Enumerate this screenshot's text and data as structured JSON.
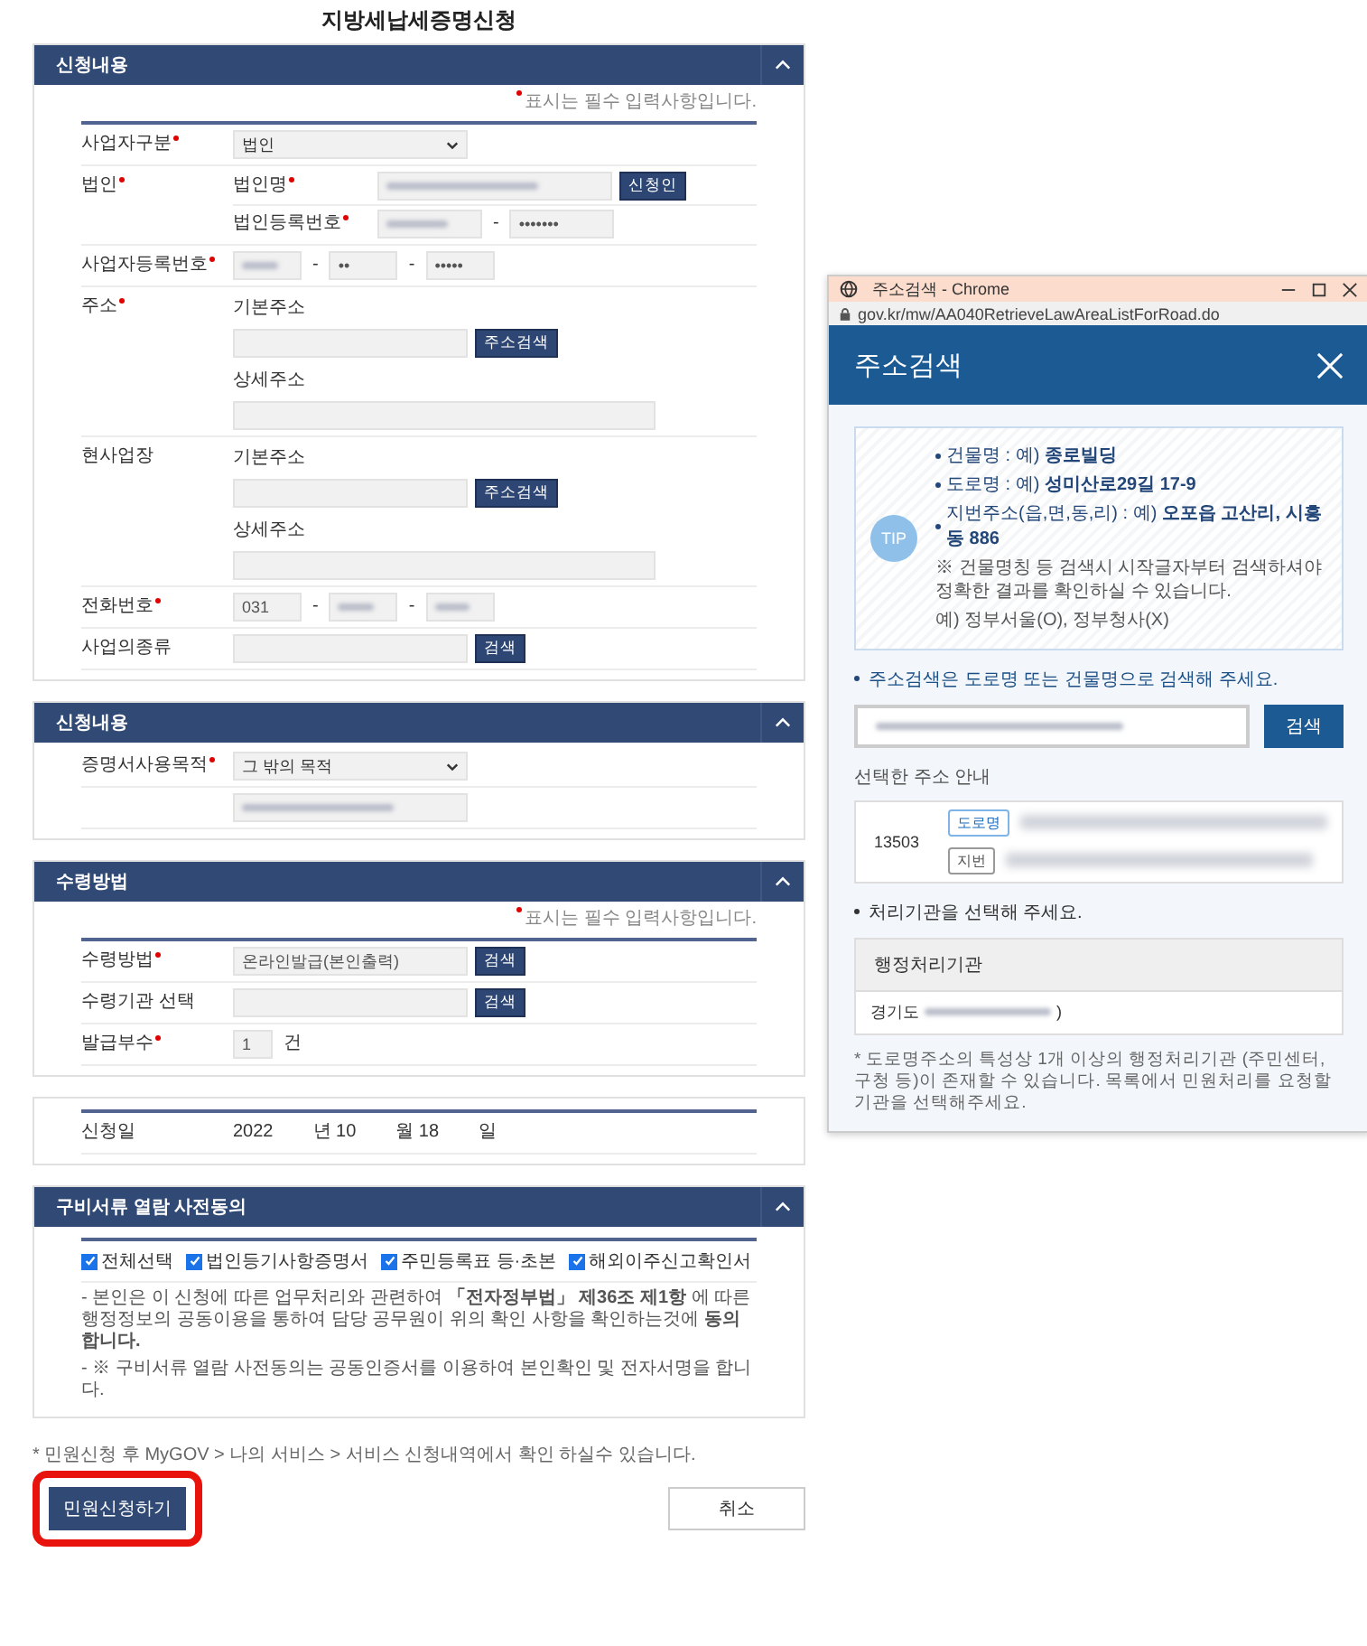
{
  "page_title": "지방세납세증명신청",
  "sections": [
    {
      "title": "신청내용",
      "expanded": true,
      "required_note": "표시는 필수 입력사항입니다.",
      "top_rule": true,
      "rows": [
        {
          "label": "사업자구분",
          "required": true,
          "lines": [
            {
              "parts": [
                {
                  "kind": "select",
                  "value": "법인"
                }
              ]
            }
          ]
        },
        {
          "label": "법인",
          "required": true,
          "lines": [
            {
              "parts": [
                {
                  "kind": "field-label",
                  "text": "법인명",
                  "required": true
                },
                {
                  "kind": "input",
                  "masked": true
                },
                {
                  "kind": "button",
                  "text": "신청인"
                }
              ]
            },
            {
              "parts": [
                {
                  "kind": "field-label",
                  "text": "법인등록번호",
                  "required": true
                },
                {
                  "kind": "mid-input",
                  "masked": true
                },
                {
                  "kind": "dash",
                  "text": "-"
                },
                {
                  "kind": "mid-input",
                  "value": "•••••••"
                }
              ]
            }
          ]
        },
        {
          "label": "사업자등록번호",
          "required": true,
          "lines": [
            {
              "parts": [
                {
                  "kind": "short-input",
                  "masked": true
                },
                {
                  "kind": "dash",
                  "text": "-"
                },
                {
                  "kind": "short-input",
                  "value": "••"
                },
                {
                  "kind": "dash",
                  "text": "-"
                },
                {
                  "kind": "short-input",
                  "value": "•••••"
                }
              ]
            }
          ]
        },
        {
          "label": "주소",
          "required": true,
          "lines": [
            {
              "parts": [
                {
                  "kind": "caption",
                  "text": "기본주소"
                }
              ]
            },
            {
              "parts": [
                {
                  "kind": "input"
                },
                {
                  "kind": "button",
                  "text": "주소검색"
                }
              ]
            },
            {
              "parts": [
                {
                  "kind": "caption",
                  "text": "상세주소"
                }
              ]
            },
            {
              "parts": [
                {
                  "kind": "wide-input"
                }
              ]
            }
          ]
        },
        {
          "label": "현사업장",
          "required": false,
          "lines": [
            {
              "parts": [
                {
                  "kind": "caption",
                  "text": "기본주소"
                }
              ]
            },
            {
              "parts": [
                {
                  "kind": "input"
                },
                {
                  "kind": "button",
                  "text": "주소검색"
                }
              ]
            },
            {
              "parts": [
                {
                  "kind": "caption",
                  "text": "상세주소"
                }
              ]
            },
            {
              "parts": [
                {
                  "kind": "wide-input"
                }
              ]
            }
          ]
        },
        {
          "label": "전화번호",
          "required": true,
          "lines": [
            {
              "parts": [
                {
                  "kind": "short-input",
                  "value": "031"
                },
                {
                  "kind": "dash",
                  "text": "-"
                },
                {
                  "kind": "short-input",
                  "masked": true
                },
                {
                  "kind": "dash",
                  "text": "-"
                },
                {
                  "kind": "short-input",
                  "masked": true
                }
              ]
            }
          ]
        },
        {
          "label": "사업의종류",
          "required": false,
          "lines": [
            {
              "parts": [
                {
                  "kind": "input"
                },
                {
                  "kind": "button",
                  "text": "검색"
                }
              ]
            }
          ]
        }
      ]
    },
    {
      "title": "신청내용",
      "expanded": true,
      "top_rule": false,
      "rows": [
        {
          "label": "증명서사용목적",
          "required": true,
          "lines": [
            {
              "parts": [
                {
                  "kind": "select",
                  "value": "그 밖의 목적"
                }
              ]
            }
          ]
        },
        {
          "lines": [
            {
              "parts": [
                {
                  "kind": "input",
                  "masked": true
                }
              ]
            }
          ]
        }
      ]
    },
    {
      "title": "수령방법",
      "expanded": true,
      "required_note": "표시는 필수 입력사항입니다.",
      "top_rule": true,
      "rows": [
        {
          "label": "수령방법",
          "required": true,
          "lines": [
            {
              "parts": [
                {
                  "kind": "input",
                  "value": "온라인발급(본인출력)"
                },
                {
                  "kind": "button",
                  "text": "검색"
                }
              ]
            }
          ]
        },
        {
          "label": "수령기관 선택",
          "required": false,
          "lines": [
            {
              "parts": [
                {
                  "kind": "input"
                },
                {
                  "kind": "button",
                  "text": "검색"
                }
              ]
            }
          ]
        },
        {
          "label": "발급부수",
          "required": true,
          "lines": [
            {
              "parts": [
                {
                  "kind": "tiny-input",
                  "value": "1"
                },
                {
                  "kind": "unit",
                  "text": "건"
                }
              ]
            }
          ]
        }
      ]
    },
    {
      "top_rule": true,
      "rows": [
        {
          "label": "신청일",
          "required": false,
          "lines": [
            {
              "parts": [
                {
                  "kind": "text",
                  "text": "2022"
                },
                {
                  "kind": "text",
                  "text": "년 10"
                },
                {
                  "kind": "text",
                  "text": "월 18"
                },
                {
                  "kind": "text",
                  "text": "일"
                }
              ]
            }
          ]
        }
      ]
    },
    {
      "title": "구비서류 열람 사전동의",
      "expanded": true,
      "top_rule": true,
      "checks": [
        {
          "label": "전체선택",
          "checked": true
        },
        {
          "label": "법인등기사항증명서",
          "checked": true
        },
        {
          "label": "주민등록표 등·초본",
          "checked": true
        },
        {
          "label": "해외이주신고확인서",
          "checked": true
        }
      ],
      "notes": [
        "- 본인은 이 신청에 따른 업무처리와 관련하여 **「전자정부법」 제36조 제1항** 에 따른 행정정보의 공동이용을 통하여 담당 공무원이 위의 확인 사항을 확인하는것에 **동의합니다.**",
        "- ※ 구비서류 열람 사전동의는 공동인증서를 이용하여 본인확인 및 전자서명을 합니다."
      ]
    }
  ],
  "footer_note": "* 민원신청 후 MyGOV > 나의 서비스 > 서비스 신청내역에서 확인 하실수 있습니다.",
  "submit": {
    "label": "민원신청하기",
    "highlighted": true
  },
  "cancel": {
    "label": "취소"
  },
  "popup": {
    "window_title": "주소검색 - Chrome",
    "url": "gov.kr/mw/AA040RetrieveLawAreaListForRoad.do",
    "heading": "주소검색",
    "tip_badge": "TIP",
    "tips": [
      "건물명 : 예) **종로빌딩**",
      "도로명 : 예) **성미산로29길 17-9**",
      "지번주소(읍,면,동,리) : 예) **오포읍 고산리, 시흥동 886**"
    ],
    "tip_note": "※ 건물명칭 등 검색시 시작글자부터 검색하셔야 정확한 결과를 확인하실 수 있습니다.",
    "tip_example": "예) 정부서울(O), 정부청사(X)",
    "search_hint": "주소검색은 도로명 또는 건물명으로 검색해 주세요.",
    "search": {
      "masked": true
    },
    "search_button": "검색",
    "selected_heading": "선택한 주소 안내",
    "result": {
      "postcode": "13503",
      "tags": [
        {
          "label": "도로명",
          "selected": true
        },
        {
          "label": "지번",
          "selected": false
        }
      ]
    },
    "agency_hint": "처리기관을 선택해 주세요.",
    "agency_header": "행정처리기관",
    "agency_rows": [
      {
        "prefix": "경기도",
        "masked": true,
        "suffix": ")"
      }
    ],
    "footnote": "* 도로명주소의 특성상 1개 이상의 행정처리기관 (주민센터, 구청 등)이 존재할 수 있습니다. 목록에서 민원처리를 요청할 기관을 선택해주세요."
  }
}
